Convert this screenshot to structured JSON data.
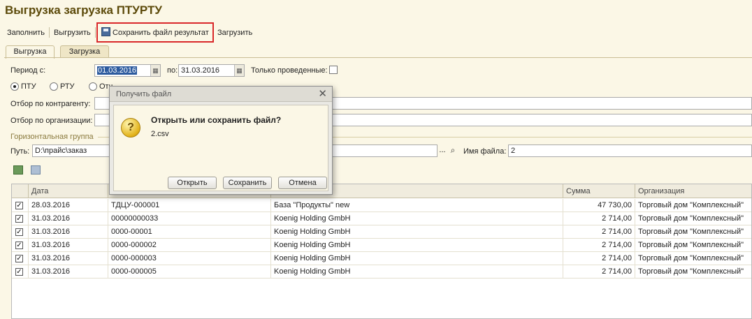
{
  "window": {
    "title": "Выгрузка загрузка ПТУРТУ"
  },
  "toolbar": {
    "fill_label": "Заполнить",
    "export_label": "Выгрузить",
    "save_result_label": "Сохранить файл результат",
    "import_label": "Загрузить"
  },
  "tabs": [
    {
      "label": "Выгрузка",
      "active": true
    },
    {
      "label": "Загрузка",
      "active": false
    }
  ],
  "filters": {
    "period_from_label": "Период с:",
    "period_from_value": "01.03.2016",
    "period_to_label": "по:",
    "period_to_value": "31.03.2016",
    "only_posted_label": "Только проведенные:",
    "only_posted_checked": false,
    "radio_options": [
      {
        "label": "ПТУ",
        "selected": true
      },
      {
        "label": "РТУ",
        "selected": false
      },
      {
        "label": "Отч",
        "selected": false
      }
    ],
    "counterparty_label": "Отбор по контрагенту:",
    "counterparty_value": "",
    "organization_label": "Отбор по организации:",
    "organization_value": ""
  },
  "group": {
    "label": "Горизонтальная группа",
    "path_label": "Путь:",
    "path_value": "D:\\прайс\\заказ",
    "browse_label": "...",
    "filename_label": "Имя файла:",
    "filename_value": "2"
  },
  "table": {
    "columns": [
      "Дата",
      "",
      "",
      "Сумма",
      "Организация"
    ],
    "rows": [
      {
        "checked": true,
        "date": "28.03.2016",
        "number": "ТДЦУ-000001",
        "counterparty": "База \"Продукты\" new",
        "sum": "47 730,00",
        "org": "Торговый дом \"Комплексный\""
      },
      {
        "checked": true,
        "date": "31.03.2016",
        "number": "00000000033",
        "counterparty": "Koenig Holding GmbH",
        "sum": "2 714,00",
        "org": "Торговый дом \"Комплексный\""
      },
      {
        "checked": true,
        "date": "31.03.2016",
        "number": "0000-00001",
        "counterparty": "Koenig Holding GmbH",
        "sum": "2 714,00",
        "org": "Торговый дом \"Комплексный\""
      },
      {
        "checked": true,
        "date": "31.03.2016",
        "number": "0000-000002",
        "counterparty": "Koenig Holding GmbH",
        "sum": "2 714,00",
        "org": "Торговый дом \"Комплексный\""
      },
      {
        "checked": true,
        "date": "31.03.2016",
        "number": "0000-000003",
        "counterparty": "Koenig Holding GmbH",
        "sum": "2 714,00",
        "org": "Торговый дом \"Комплексный\""
      },
      {
        "checked": true,
        "date": "31.03.2016",
        "number": "0000-000005",
        "counterparty": "Koenig Holding GmbH",
        "sum": "2 714,00",
        "org": "Торговый дом \"Комплексный\""
      }
    ]
  },
  "dialog": {
    "title": "Получить файл",
    "question": "Открыть или сохранить файл?",
    "filename": "2.csv",
    "open_label": "Открыть",
    "save_label": "Сохранить",
    "cancel_label": "Отмена"
  },
  "colors": {
    "background": "#fbf7e6",
    "title": "#5c4a0a",
    "highlight_border": "#d9282a",
    "selection": "#2c5a9e"
  }
}
